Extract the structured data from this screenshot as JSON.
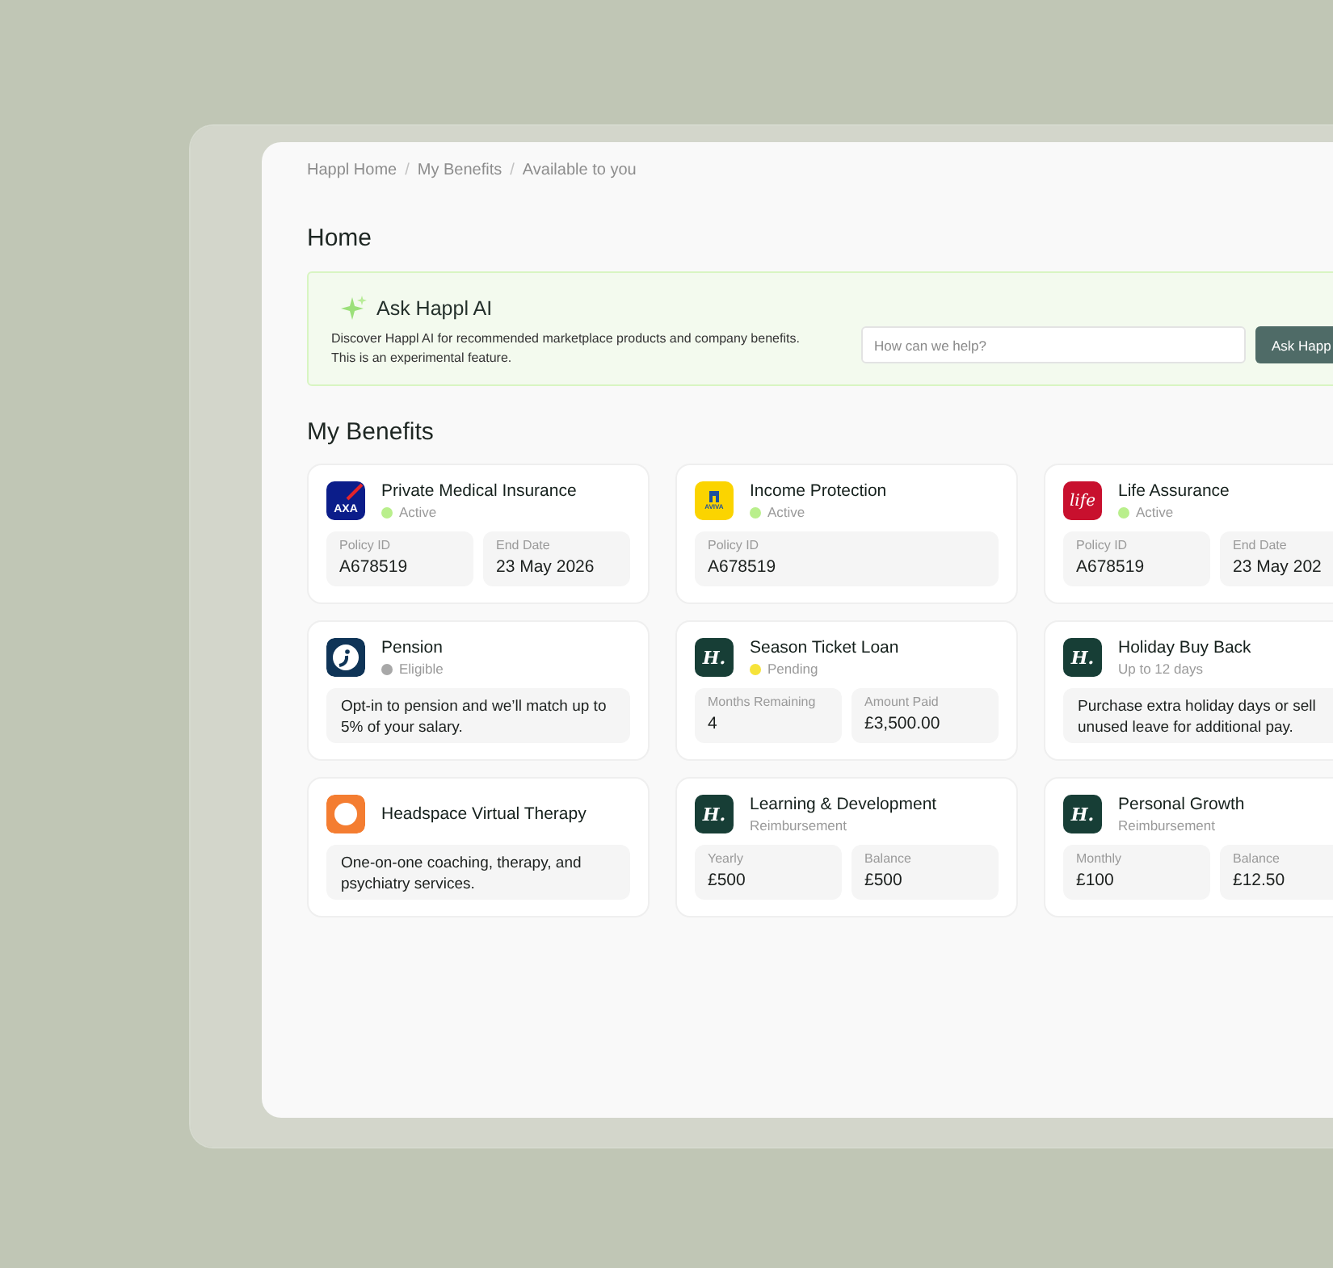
{
  "breadcrumb": [
    {
      "label": "Happl Home"
    },
    {
      "separator": "/",
      "label": "My Benefits"
    },
    {
      "separator": "/",
      "label": "Available to you"
    }
  ],
  "page_title": "Home",
  "ai_panel": {
    "title": "Ask Happl AI",
    "description": "Discover Happl AI for recommended marketplace products and company benefits. This is an experimental feature.",
    "placeholder": "How can we help?",
    "button": "Ask Happ"
  },
  "section_title": "My Benefits",
  "benefits": [
    {
      "title": "Private Medical Insurance",
      "logo": {
        "kind": "axa",
        "text": "AXA"
      },
      "subtitle": {
        "kind": "status",
        "text": "Active",
        "color": "#b9ef8c"
      },
      "body": {
        "kind": "fields",
        "fields": [
          {
            "label": "Policy ID",
            "value": "A678519"
          },
          {
            "label": "End Date",
            "value": "23 May 2026"
          }
        ]
      }
    },
    {
      "title": "Income Protection",
      "logo": {
        "kind": "aviva",
        "text": "AVIVA"
      },
      "subtitle": {
        "kind": "status",
        "text": "Active",
        "color": "#b9ef8c"
      },
      "body": {
        "kind": "fields",
        "fields": [
          {
            "label": "Policy ID",
            "value": "A678519"
          }
        ]
      }
    },
    {
      "title": "Life Assurance",
      "logo": {
        "kind": "life",
        "text": "life"
      },
      "subtitle": {
        "kind": "status",
        "text": "Active",
        "color": "#b9ef8c"
      },
      "body": {
        "kind": "fields",
        "fields": [
          {
            "label": "Policy ID",
            "value": "A678519"
          },
          {
            "label": "End Date",
            "value": "23 May 202"
          }
        ]
      }
    },
    {
      "title": "Pension",
      "logo": {
        "kind": "pension"
      },
      "subtitle": {
        "kind": "status",
        "text": "Eligible",
        "color": "#a8a8a8"
      },
      "body": {
        "kind": "text",
        "text": "Opt-in to pension and we’ll match up to 5% of your salary."
      }
    },
    {
      "title": "Season Ticket Loan",
      "logo": {
        "kind": "happl",
        "text": "H."
      },
      "subtitle": {
        "kind": "status",
        "text": "Pending",
        "color": "#f6e33a"
      },
      "body": {
        "kind": "fields",
        "fields": [
          {
            "label": "Months Remaining",
            "value": "4"
          },
          {
            "label": "Amount Paid",
            "value": "£3,500.00"
          }
        ]
      }
    },
    {
      "title": "Holiday Buy Back",
      "logo": {
        "kind": "happl",
        "text": "H."
      },
      "subtitle": {
        "kind": "text",
        "text": "Up to 12 days"
      },
      "body": {
        "kind": "text",
        "text": "Purchase extra holiday days or sell unused leave for additional pay."
      }
    },
    {
      "title": "Headspace Virtual Therapy",
      "logo": {
        "kind": "headspace"
      },
      "body": {
        "kind": "text",
        "text": "One-on-one coaching, therapy, and psychiatry services."
      }
    },
    {
      "title": "Learning & Development",
      "logo": {
        "kind": "happl",
        "text": "H."
      },
      "subtitle": {
        "kind": "text",
        "text": "Reimbursement"
      },
      "body": {
        "kind": "fields",
        "fields": [
          {
            "label": "Yearly",
            "value": "£500"
          },
          {
            "label": "Balance",
            "value": "£500"
          }
        ]
      }
    },
    {
      "title": "Personal Growth",
      "logo": {
        "kind": "happl",
        "text": "H."
      },
      "subtitle": {
        "kind": "text",
        "text": "Reimbursement"
      },
      "body": {
        "kind": "fields",
        "fields": [
          {
            "label": "Monthly",
            "value": "£100"
          },
          {
            "label": "Balance",
            "value": "£12.50"
          }
        ]
      }
    }
  ]
}
